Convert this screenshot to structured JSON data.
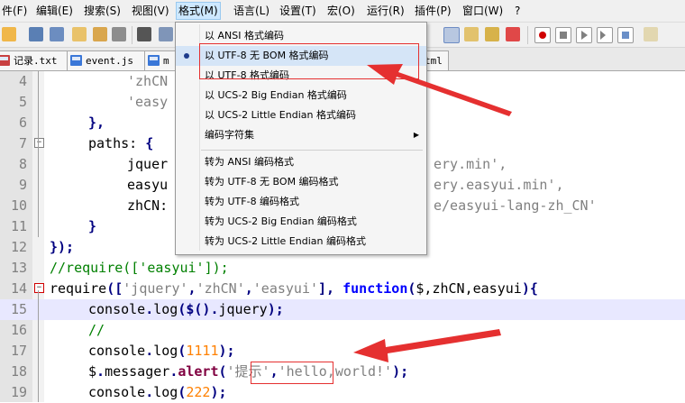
{
  "menubar": {
    "items": [
      "件(F)",
      "编辑(E)",
      "搜索(S)",
      "视图(V)",
      "格式(M)",
      "语言(L)",
      "设置(T)",
      "宏(O)",
      "运行(R)",
      "插件(P)",
      "窗口(W)",
      "?"
    ]
  },
  "tabs": [
    {
      "label": "记录.txt"
    },
    {
      "label": "event.js"
    },
    {
      "label": "m"
    },
    {
      "label": "tml"
    }
  ],
  "editor": {
    "lines": [
      {
        "n": "4"
      },
      {
        "n": "5"
      },
      {
        "n": "6"
      },
      {
        "n": "7"
      },
      {
        "n": "8"
      },
      {
        "n": "9"
      },
      {
        "n": "10"
      },
      {
        "n": "11"
      },
      {
        "n": "12"
      },
      {
        "n": "13"
      },
      {
        "n": "14"
      },
      {
        "n": "15"
      },
      {
        "n": "16"
      },
      {
        "n": "17"
      },
      {
        "n": "18"
      },
      {
        "n": "19"
      }
    ],
    "code": {
      "l4": "'zhCN",
      "l5": "'easy",
      "l6": "},",
      "l7_a": "paths:",
      "l7_b": " {",
      "l8_a": "jquer",
      "l8_b": "ery.min',",
      "l9_a": "easyu",
      "l9_b": "ery.easyui.min',",
      "l10_a": "zhCN:",
      "l10_b": "e/easyui-lang-zh_CN'",
      "l11": "}",
      "l12": "});",
      "l13": "//require(['easyui']);",
      "l14_a": "require",
      "l14_b": "([",
      "l14_c": "'jquery'",
      "l14_d": ",",
      "l14_e": "'zhCN'",
      "l14_f": ",",
      "l14_g": "'easyui'",
      "l14_h": "], ",
      "l14_i": "function",
      "l14_j": "(",
      "l14_k": "$,zhCN,easyui",
      "l14_l": "){",
      "l15_a": "console",
      "l15_b": ".",
      "l15_c": "log",
      "l15_d": "($().",
      "l15_e": "jquery",
      "l15_f": ");",
      "l16": "//",
      "l17_a": "console",
      "l17_b": ".",
      "l17_c": "log",
      "l17_d": "(",
      "l17_e": "1111",
      "l17_f": ");",
      "l18_a": "$",
      "l18_b": ".",
      "l18_c": "messager",
      "l18_d": ".",
      "l18_e": "alert",
      "l18_f": "(",
      "l18_g": "'提示'",
      "l18_h": ",",
      "l18_i": "'hello,world!'",
      "l18_j": ");",
      "l19_a": "console",
      "l19_b": ".",
      "l19_c": "log",
      "l19_d": "(",
      "l19_e": "222",
      "l19_f": ");"
    }
  },
  "format_menu": {
    "items": [
      {
        "label": "以 ANSI 格式编码"
      },
      {
        "label": "以 UTF-8 无 BOM 格式编码",
        "checked": true
      },
      {
        "label": "以 UTF-8 格式编码"
      },
      {
        "label": "以 UCS-2 Big Endian 格式编码"
      },
      {
        "label": "以 UCS-2 Little Endian 格式编码"
      },
      {
        "label": "编码字符集"
      },
      {
        "label": "转为 ANSI 编码格式"
      },
      {
        "label": "转为 UTF-8 无 BOM 编码格式"
      },
      {
        "label": "转为 UTF-8 编码格式"
      },
      {
        "label": "转为 UCS-2 Big Endian 编码格式"
      },
      {
        "label": "转为 UCS-2 Little Endian 编码格式"
      }
    ]
  },
  "colors": {
    "annotation_red": "#e53030",
    "keyword_blue": "#0000ff",
    "string_gray": "#808080",
    "number_orange": "#ff8000",
    "comment_green": "#008000",
    "current_line": "#e8e8ff"
  }
}
